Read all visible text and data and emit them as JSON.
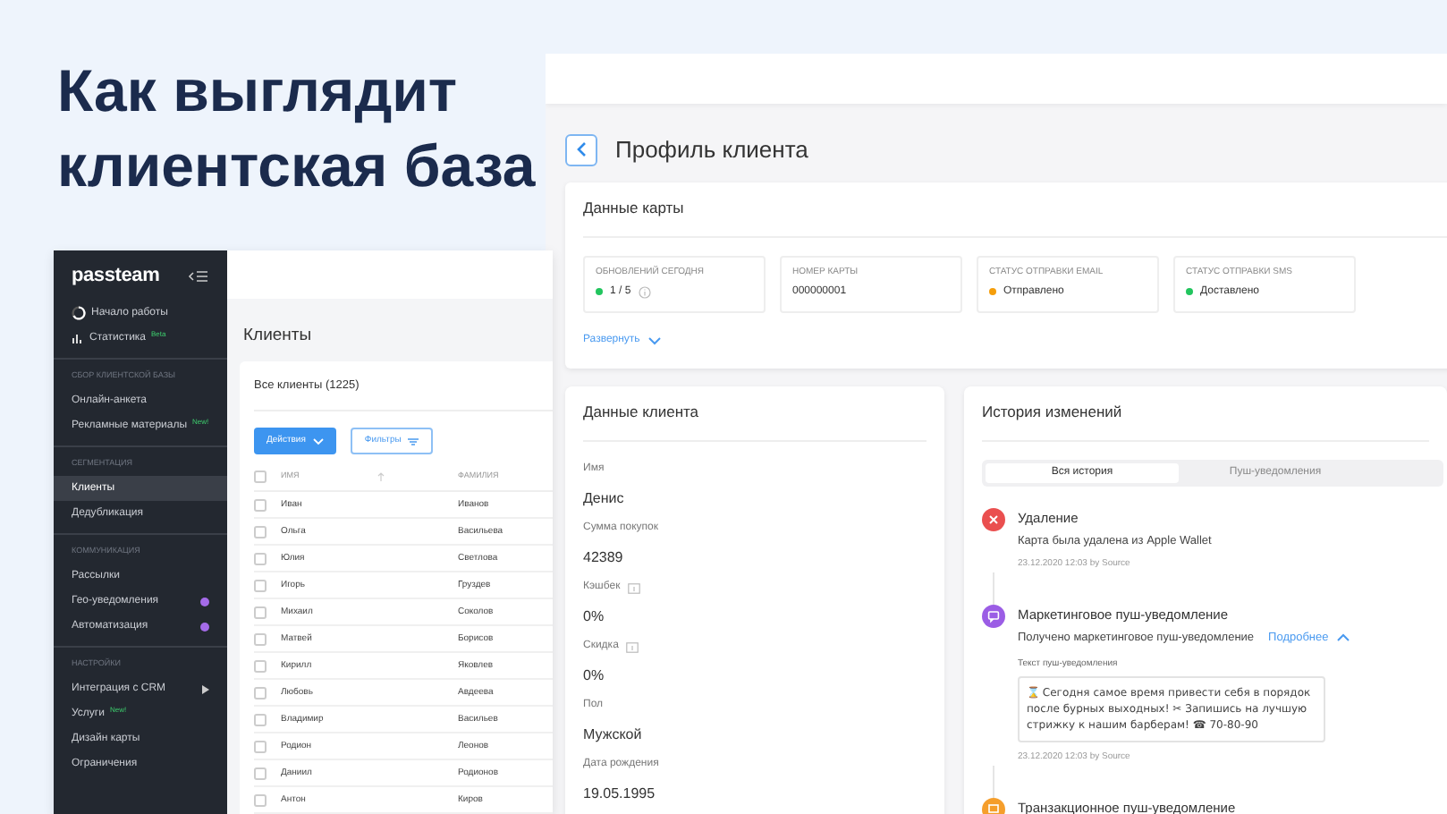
{
  "headline": [
    "Как выглядит",
    "клиентская база"
  ],
  "clients_window": {
    "sidebar": {
      "logo": "passteam",
      "groups": [
        {
          "items": [
            {
              "label": "Начало работы",
              "kind": "progress",
              "selected": false
            },
            {
              "label": "Статистика",
              "kind": "stats",
              "badge": "Beta",
              "selected": false
            }
          ]
        },
        {
          "heading": "СБОР КЛИЕНТСКОЙ БАЗЫ",
          "items": [
            {
              "label": "Онлайн-анкета",
              "kind": "plain",
              "selected": false
            },
            {
              "label": "Рекламные материалы",
              "kind": "plain",
              "badge": "New!",
              "selected": false
            }
          ]
        },
        {
          "heading": "СЕГМЕНТАЦИЯ",
          "items": [
            {
              "label": "Клиенты",
              "kind": "plain",
              "selected": true
            },
            {
              "label": "Дедубликация",
              "kind": "plain",
              "selected": false
            }
          ]
        },
        {
          "heading": "КОММУНИКАЦИЯ",
          "items": [
            {
              "label": "Рассылки",
              "kind": "plain",
              "selected": false
            },
            {
              "label": "Гео-уведомления",
              "kind": "dot",
              "selected": false
            },
            {
              "label": "Автоматизация",
              "kind": "dot",
              "selected": false
            }
          ]
        },
        {
          "heading": "НАСТРОЙКИ",
          "items": [
            {
              "label": "Интеграция с CRM",
              "kind": "submenu",
              "selected": false
            },
            {
              "label": "Услуги",
              "kind": "plain",
              "badge": "New!",
              "selected": false
            },
            {
              "label": "Дизайн карты",
              "kind": "plain",
              "selected": false
            },
            {
              "label": "Ограничения",
              "kind": "plain",
              "selected": false
            }
          ]
        }
      ]
    },
    "title": "Клиенты",
    "card_title": "Все клиенты (1225)",
    "buttons": [
      {
        "label": "Действия",
        "kind": "primary"
      },
      {
        "label": "Фильтры",
        "kind": "outline"
      }
    ],
    "table": {
      "select_all_checked": false,
      "columns": [
        "ИМЯ",
        "ФАМИЛИЯ"
      ],
      "rows": [
        {
          "checked": false,
          "cells": [
            "Иван",
            "Иванов"
          ]
        },
        {
          "checked": false,
          "cells": [
            "Ольга",
            "Васильева"
          ]
        },
        {
          "checked": false,
          "cells": [
            "Юлия",
            "Светлова"
          ]
        },
        {
          "checked": false,
          "cells": [
            "Игорь",
            "Груздев"
          ]
        },
        {
          "checked": false,
          "cells": [
            "Михаил",
            "Соколов"
          ]
        },
        {
          "checked": false,
          "cells": [
            "Матвей",
            "Борисов"
          ]
        },
        {
          "checked": false,
          "cells": [
            "Кирилл",
            "Яковлев"
          ]
        },
        {
          "checked": false,
          "cells": [
            "Любовь",
            "Авдеева"
          ]
        },
        {
          "checked": false,
          "cells": [
            "Владимир",
            "Васильев"
          ]
        },
        {
          "checked": false,
          "cells": [
            "Родион",
            "Леонов"
          ]
        },
        {
          "checked": false,
          "cells": [
            "Даниил",
            "Родионов"
          ]
        },
        {
          "checked": false,
          "cells": [
            "Антон",
            "Киров"
          ]
        }
      ]
    }
  },
  "profile_window": {
    "title": "Профиль клиента",
    "card_data": {
      "title": "Данные карты",
      "tiles": [
        {
          "label": "ОБНОВЛЕНИЙ СЕГОДНЯ",
          "value": "1 / 5",
          "color": "#22c55e",
          "info": true
        },
        {
          "label": "НОМЕР КАРТЫ",
          "value": "000000001"
        },
        {
          "label": "СТАТУС ОТПРАВКИ EMAIL",
          "value": "Отправлено",
          "color": "#f59e0b"
        },
        {
          "label": "СТАТУС ОТПРАВКИ SMS",
          "value": "Доставлено",
          "color": "#22c55e"
        }
      ],
      "expand_link": "Развернуть"
    },
    "client_data": {
      "title": "Данные клиента",
      "fields": [
        {
          "label": "Имя",
          "value": "Денис",
          "info": false
        },
        {
          "label": "Сумма покупок",
          "value": "42389",
          "info": false
        },
        {
          "label": "Кэшбек",
          "value": "0%",
          "info": true
        },
        {
          "label": "Скидка",
          "value": "0%",
          "info": true
        },
        {
          "label": "Пол",
          "value": "Мужской",
          "info": false
        },
        {
          "label": "Дата рождения",
          "value": "19.05.1995",
          "info": false
        }
      ]
    },
    "history": {
      "title": "История изменений",
      "tabs": [
        {
          "label": "Вся история",
          "selected": true
        },
        {
          "label": "Пуш-уведомления",
          "selected": false
        }
      ],
      "events": [
        {
          "kind": "delete",
          "title": "Удаление",
          "text": "Карта была удалена из Apple Wallet",
          "meta": "23.12.2020 12:03 by Source"
        },
        {
          "kind": "marketing",
          "title": "Маркетинговое пуш-уведомление",
          "text": "Получено маркетинговое пуш-уведомление",
          "link": "Подробнее",
          "expanded": true,
          "message_label": "Текст пуш-уведомления",
          "message": "⌛ Сегодня самое время привести себя в порядок после бурных выходных! ✂ Запишись на лучшую стрижку к нашим барберам! ☎ 70-80-90",
          "meta": "23.12.2020 12:03 by Source"
        },
        {
          "kind": "transaction",
          "title": "Транзакционное пуш-уведомление"
        }
      ]
    }
  }
}
